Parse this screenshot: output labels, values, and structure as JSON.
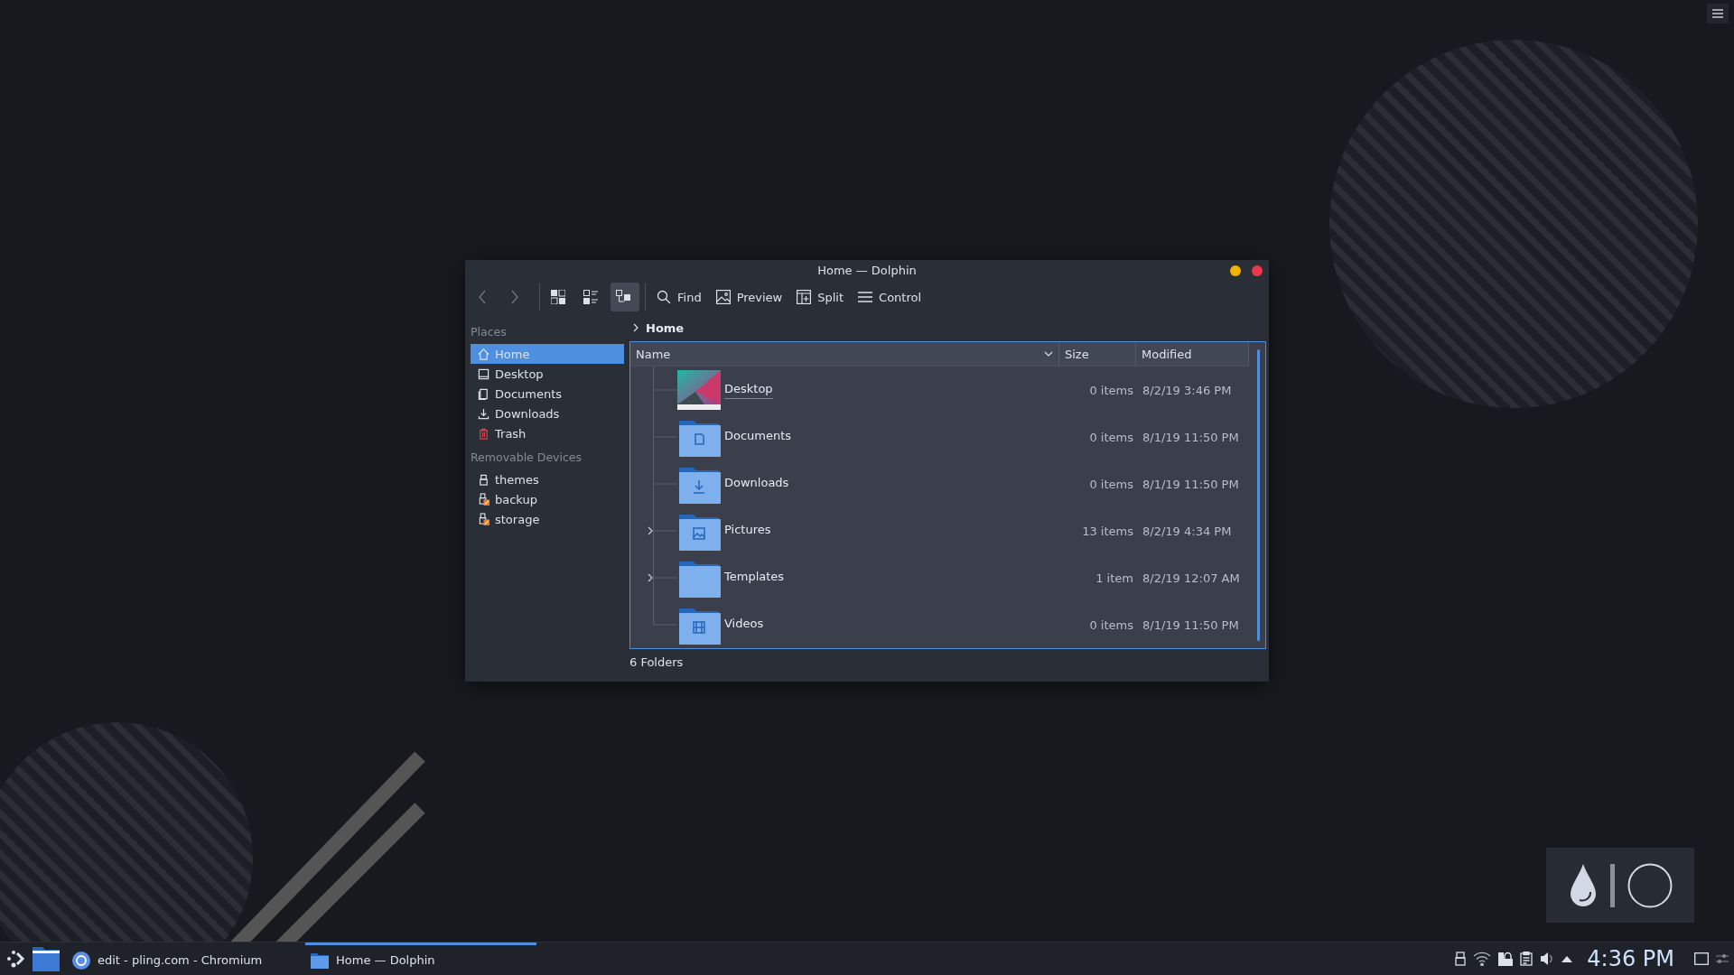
{
  "window": {
    "title": "Home — Dolphin"
  },
  "toolbar": [
    {
      "kind": "back",
      "selected": false
    },
    {
      "kind": "forward",
      "selected": false
    },
    {
      "kind": "icons-view",
      "selected": false
    },
    {
      "kind": "compact-view",
      "selected": false
    },
    {
      "kind": "details-view",
      "selected": true
    },
    {
      "kind": "find",
      "label": "Find",
      "selected": false
    },
    {
      "kind": "preview",
      "label": "Preview",
      "selected": false
    },
    {
      "kind": "split",
      "label": "Split",
      "selected": false
    },
    {
      "kind": "control",
      "label": "Control",
      "selected": false
    }
  ],
  "sidebar": {
    "sections": [
      {
        "title": "Places",
        "items": [
          {
            "label": "Home",
            "kind": "home",
            "selected": true
          },
          {
            "label": "Desktop",
            "kind": "desktop",
            "selected": false
          },
          {
            "label": "Documents",
            "kind": "documents",
            "selected": false
          },
          {
            "label": "Downloads",
            "kind": "downloads",
            "selected": false
          },
          {
            "label": "Trash",
            "kind": "trash",
            "selected": false
          }
        ]
      },
      {
        "title": "Removable Devices",
        "items": [
          {
            "label": "themes",
            "kind": "drive",
            "selected": false
          },
          {
            "label": "backup",
            "kind": "drive-unmounted",
            "selected": false
          },
          {
            "label": "storage",
            "kind": "drive-unmounted",
            "selected": false
          }
        ]
      }
    ]
  },
  "breadcrumb": [
    "Home"
  ],
  "table": {
    "columns": [
      "Name",
      "Size",
      "Modified"
    ],
    "rows": [
      {
        "name": "Desktop",
        "kind": "desktop",
        "size": "0 items",
        "modified": "8/2/19 3:46 PM",
        "expandable": false,
        "hovered": true
      },
      {
        "name": "Documents",
        "kind": "documents",
        "size": "0 items",
        "modified": "8/1/19 11:50 PM",
        "expandable": false,
        "hovered": false
      },
      {
        "name": "Downloads",
        "kind": "downloads",
        "size": "0 items",
        "modified": "8/1/19 11:50 PM",
        "expandable": false,
        "hovered": false
      },
      {
        "name": "Pictures",
        "kind": "pictures",
        "size": "13 items",
        "modified": "8/2/19 4:34 PM",
        "expandable": true,
        "hovered": false
      },
      {
        "name": "Templates",
        "kind": "templates",
        "size": "1 item",
        "modified": "8/2/19 12:07 AM",
        "expandable": true,
        "hovered": false
      },
      {
        "name": "Videos",
        "kind": "videos",
        "size": "0 items",
        "modified": "8/1/19 11:50 PM",
        "expandable": false,
        "hovered": false
      }
    ]
  },
  "status_bar": "6 Folders",
  "taskbar": {
    "tasks": [
      {
        "label": "edit - pling.com - Chromium",
        "kind": "browser",
        "selected": false
      },
      {
        "label": "Home — Dolphin",
        "kind": "folder",
        "selected": true
      }
    ],
    "clock": "4:36 PM"
  }
}
